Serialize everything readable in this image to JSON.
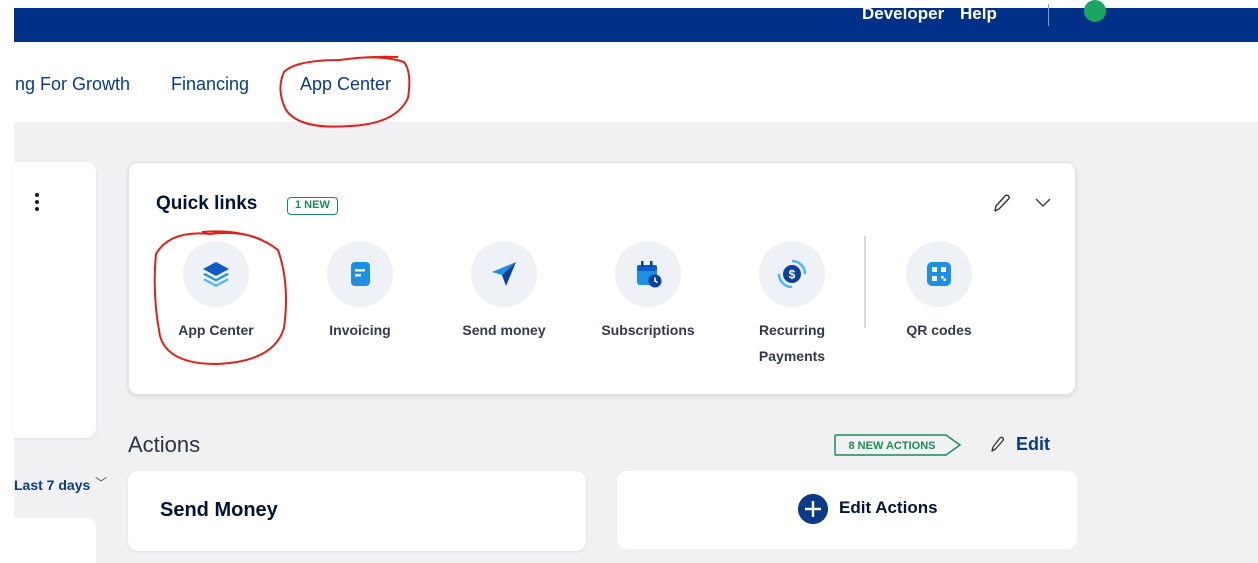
{
  "header": {
    "link_developer": "Developer",
    "link_help": "Help"
  },
  "tabs": [
    {
      "label": "Selling For Growth"
    },
    {
      "label": "Financing"
    },
    {
      "label": "App Center"
    }
  ],
  "left_panel": {
    "range_label": "Last 7 days"
  },
  "quick_links": {
    "title": "Quick links",
    "badge": "1 NEW",
    "items": [
      {
        "label": "App Center",
        "icon": "layers-icon"
      },
      {
        "label": "Invoicing",
        "icon": "invoice-icon"
      },
      {
        "label": "Send money",
        "icon": "send-icon"
      },
      {
        "label": "Subscriptions",
        "icon": "calendar-clock-icon"
      },
      {
        "label": "Recurring Payments",
        "icon": "recurring-payment-icon"
      },
      {
        "label": "QR codes",
        "icon": "qr-code-icon"
      }
    ]
  },
  "actions": {
    "title": "Actions",
    "new_badge": "8 NEW ACTIONS",
    "edit_label": "Edit",
    "cards": [
      {
        "label": "Send Money"
      },
      {
        "label": "Edit Actions"
      }
    ]
  },
  "colors": {
    "brand_blue": "#003087",
    "link_blue": "#0b3a88",
    "new_green": "#1e8a58",
    "annotation_red": "#e0201b"
  }
}
